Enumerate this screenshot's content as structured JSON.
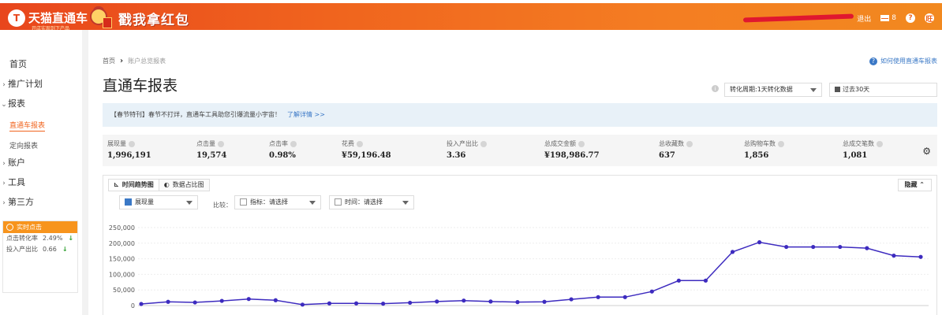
{
  "header": {
    "logo_mark": "T",
    "logo_text": "天猫直通车",
    "logo_sub": "开店实现到下产品",
    "promo_text": "戳我拿红包",
    "logout": "退出",
    "mail_count": "8",
    "help_icon": "?",
    "wang_icon": "旺"
  },
  "sidebar": {
    "items": [
      {
        "label": "首页",
        "chev": ""
      },
      {
        "label": "推广计划",
        "chev": "›"
      },
      {
        "label": "报表",
        "chev": "⌄"
      },
      {
        "label": "账户",
        "chev": "›"
      },
      {
        "label": "工具",
        "chev": "›"
      },
      {
        "label": "第三方",
        "chev": "›"
      }
    ],
    "sub_items": [
      {
        "label": "直通车报表",
        "active": true
      },
      {
        "label": "定向报表",
        "active": false
      }
    ],
    "realtime": {
      "title": "实时点击",
      "rows": [
        {
          "label": "点击转化率",
          "value": "2.49%",
          "trend": "down"
        },
        {
          "label": "投入产出比",
          "value": "0.66",
          "trend": "down"
        }
      ]
    }
  },
  "main": {
    "breadcrumb": {
      "home": "首页",
      "current": "账户总览报表"
    },
    "help_link": "如何使用直通车报表",
    "title": "直通车报表",
    "cycle_select": "转化周期:1天转化数据",
    "date_select": "过去30天",
    "notice": {
      "text": "【春节特刊】春节不打烊，直通车工具助您引爆流量小宇宙！",
      "link": "了解详情 >>"
    },
    "metrics": [
      {
        "label": "展现量",
        "value": "1,996,191"
      },
      {
        "label": "点击量",
        "value": "19,574"
      },
      {
        "label": "点击率",
        "value": "0.98%"
      },
      {
        "label": "花费",
        "value": "¥59,196.48"
      },
      {
        "label": "投入产出比",
        "value": "3.36"
      },
      {
        "label": "总成交金额",
        "value": "¥198,986.77"
      },
      {
        "label": "总收藏数",
        "value": "637"
      },
      {
        "label": "总购物车数",
        "value": "1,856"
      },
      {
        "label": "总成交笔数",
        "value": "1,081"
      }
    ],
    "tabs": [
      {
        "label": "时间趋势图",
        "icon": "⊾"
      },
      {
        "label": "数据占比图",
        "icon": "◐"
      }
    ],
    "hide_label": "隐藏 ⌃",
    "series_select": "展现量",
    "compare_label": "比较：",
    "indicator_select": "指标：请选择",
    "time_select": "时间：请选择"
  },
  "chart_data": {
    "type": "line",
    "title": "",
    "xlabel": "",
    "ylabel": "",
    "ylim": [
      0,
      250000
    ],
    "y_ticks": [
      "250,000",
      "200,000",
      "150,000",
      "100,000",
      "50,000",
      "0"
    ],
    "y_tick_values": [
      250000,
      200000,
      150000,
      100000,
      50000,
      0
    ],
    "color": "#3d2bbf",
    "series": [
      {
        "name": "展现量",
        "values": [
          5000,
          12000,
          10000,
          15000,
          21000,
          17000,
          3000,
          7000,
          7000,
          6000,
          9000,
          13000,
          16000,
          13000,
          11000,
          12000,
          20000,
          27000,
          27000,
          45000,
          80000,
          80000,
          172000,
          203000,
          188000,
          188000,
          188000,
          184000,
          160000,
          156000
        ]
      }
    ]
  }
}
